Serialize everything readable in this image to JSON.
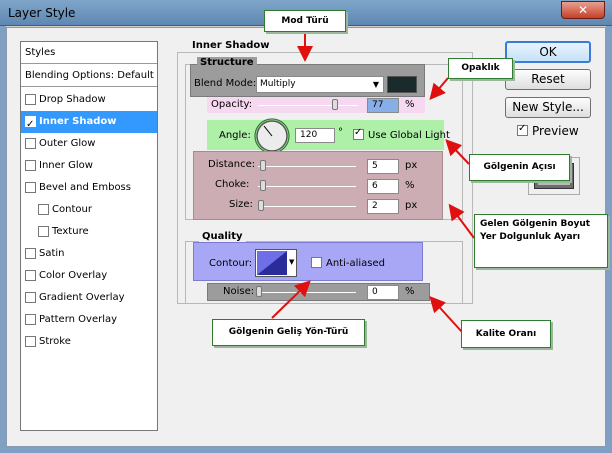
{
  "window": {
    "title": "Layer Style",
    "close_glyph": "✕"
  },
  "styles_list": {
    "header": "Styles",
    "blending": "Blending Options: Default",
    "items": [
      {
        "label": "Drop Shadow",
        "checked": false,
        "indent": false
      },
      {
        "label": "Inner Shadow",
        "checked": true,
        "indent": false,
        "selected": true
      },
      {
        "label": "Outer Glow",
        "checked": false,
        "indent": false
      },
      {
        "label": "Inner Glow",
        "checked": false,
        "indent": false
      },
      {
        "label": "Bevel and Emboss",
        "checked": false,
        "indent": false
      },
      {
        "label": "Contour",
        "checked": false,
        "indent": true
      },
      {
        "label": "Texture",
        "checked": false,
        "indent": true
      },
      {
        "label": "Satin",
        "checked": false,
        "indent": false
      },
      {
        "label": "Color Overlay",
        "checked": false,
        "indent": false
      },
      {
        "label": "Gradient Overlay",
        "checked": false,
        "indent": false
      },
      {
        "label": "Pattern Overlay",
        "checked": false,
        "indent": false
      },
      {
        "label": "Stroke",
        "checked": false,
        "indent": false
      }
    ]
  },
  "inner_shadow": {
    "title": "Inner Shadow",
    "structure": {
      "title": "Structure",
      "blend_mode_label": "Blend Mode:",
      "blend_mode_value": "Multiply",
      "swatch_color": "#1b2a2a",
      "opacity_label": "Opacity:",
      "opacity_value": "77",
      "opacity_unit": "%",
      "opacity_level": 0.77,
      "angle_label": "Angle:",
      "angle_value": "120",
      "angle_unit": "°",
      "use_global_light_label": "Use Global Light",
      "use_global_light_checked": true,
      "distance_label": "Distance:",
      "distance_value": "5",
      "distance_unit": "px",
      "choke_label": "Choke:",
      "choke_value": "6",
      "choke_unit": "%",
      "size_label": "Size:",
      "size_value": "2",
      "size_unit": "px"
    },
    "quality": {
      "title": "Quality",
      "contour_label": "Contour:",
      "anti_aliased_label": "Anti-aliased",
      "anti_aliased_checked": false,
      "noise_label": "Noise:",
      "noise_value": "0",
      "noise_unit": "%"
    }
  },
  "buttons": {
    "ok": "OK",
    "reset": "Reset",
    "new_style": "New Style...",
    "preview": "Preview",
    "preview_checked": true
  },
  "callouts": {
    "mode": "Mod Türü",
    "opacity": "Opaklık",
    "angle": "Gölgenin Açısı",
    "size": "Gelen Gölgenin Boyut Yer Dolgunluk Ayarı",
    "contour": "Gölgenin Geliş Yön-Türü",
    "quality": "Kalite Oranı"
  },
  "colors": {
    "callout_border": "#2f7b2f",
    "arrow": "#e01010",
    "selection": "#3399ff"
  }
}
